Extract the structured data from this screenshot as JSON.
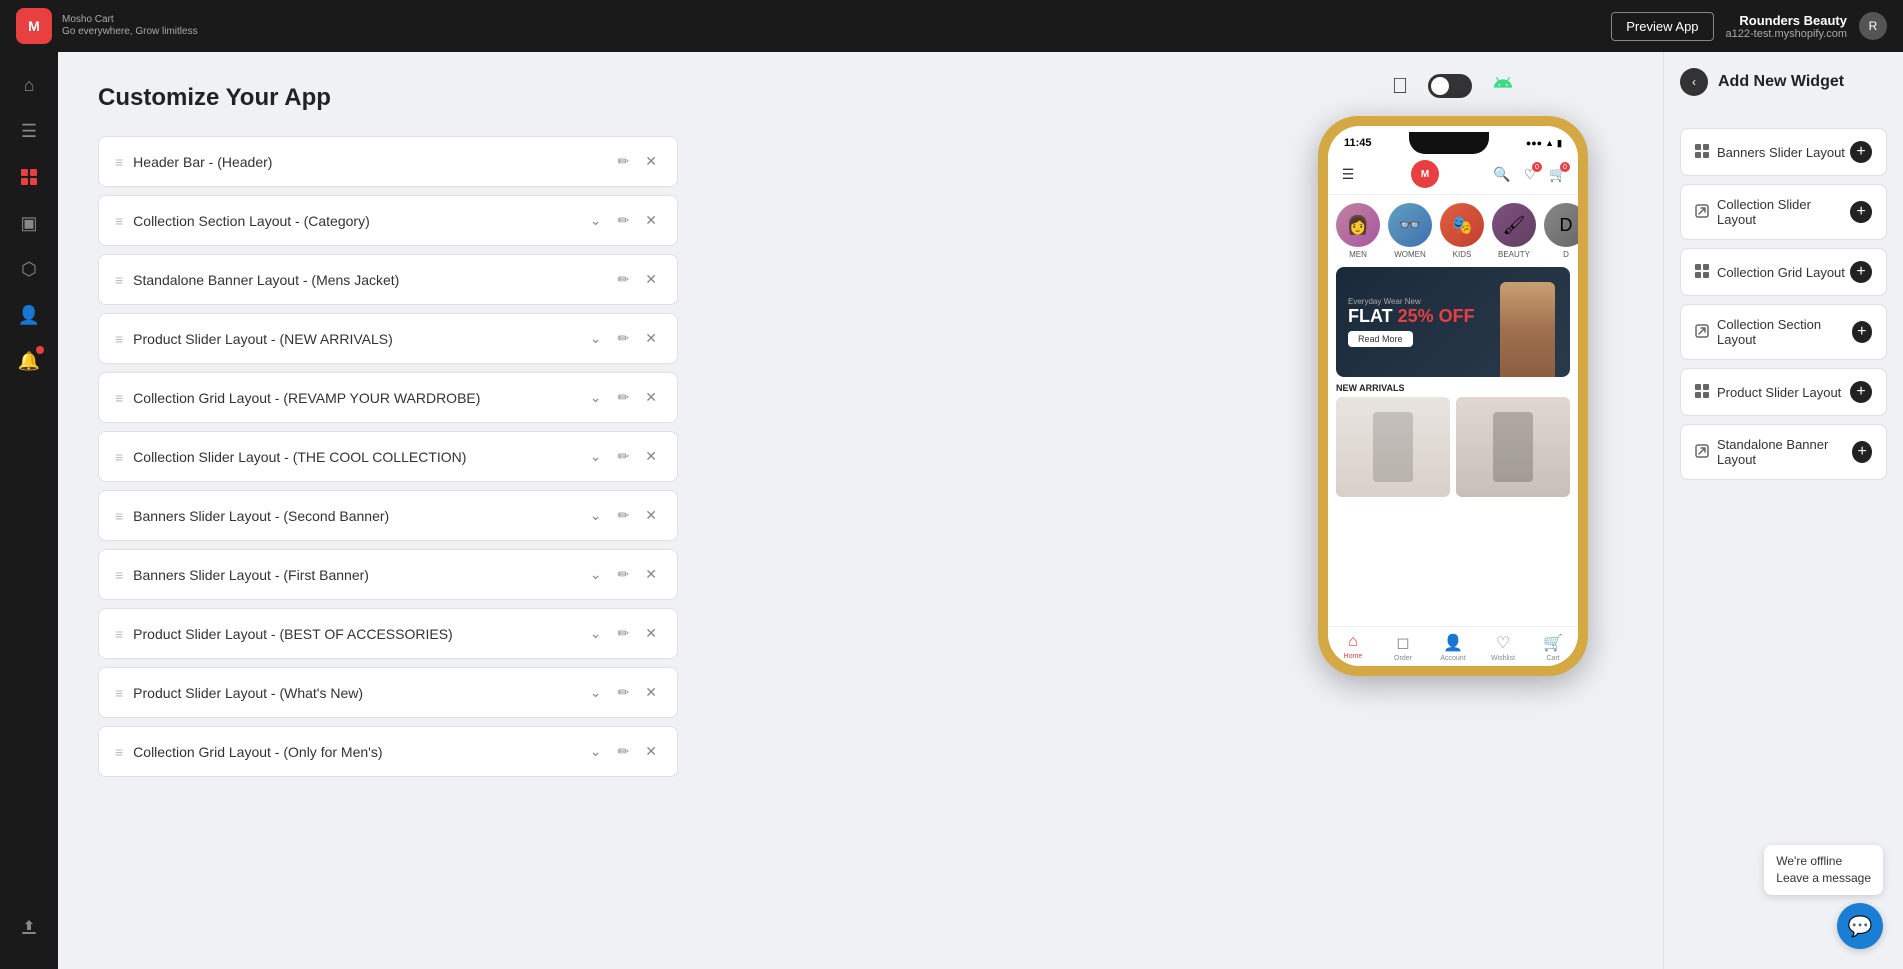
{
  "topbar": {
    "logo_letter": "M",
    "app_name": "Mosho Cart",
    "tagline": "Go everywhere, Grow limitless",
    "preview_label": "Preview App",
    "store_name": "Rounders Beauty",
    "store_url": "a122-test.myshopify.com"
  },
  "sidebar": {
    "icons": [
      {
        "name": "home-icon",
        "symbol": "⌂",
        "active": false
      },
      {
        "name": "menu-icon",
        "symbol": "☰",
        "active": false
      },
      {
        "name": "grid-icon",
        "symbol": "⊞",
        "active": true
      },
      {
        "name": "document-icon",
        "symbol": "▣",
        "active": false
      },
      {
        "name": "tag-icon",
        "symbol": "⬡",
        "active": false
      },
      {
        "name": "users-icon",
        "symbol": "👤",
        "active": false
      },
      {
        "name": "bell-icon",
        "symbol": "🔔",
        "active": false
      }
    ],
    "bottom_icon": {
      "name": "export-icon",
      "symbol": "⬆"
    }
  },
  "page": {
    "title": "Customize Your App"
  },
  "widgets": [
    {
      "id": 1,
      "name": "Header Bar - (Header)",
      "has_expand": false,
      "draggable": true
    },
    {
      "id": 2,
      "name": "Collection Section Layout - (Category)",
      "has_expand": true,
      "draggable": true
    },
    {
      "id": 3,
      "name": "Standalone Banner Layout - (Mens Jacket)",
      "has_expand": false,
      "draggable": true
    },
    {
      "id": 4,
      "name": "Product Slider Layout - (NEW ARRIVALS)",
      "has_expand": true,
      "draggable": true
    },
    {
      "id": 5,
      "name": "Collection Grid Layout - (REVAMP YOUR WARDROBE)",
      "has_expand": true,
      "draggable": true
    },
    {
      "id": 6,
      "name": "Collection Slider Layout - (THE COOL COLLECTION)",
      "has_expand": true,
      "draggable": true
    },
    {
      "id": 7,
      "name": "Banners Slider Layout - (Second Banner)",
      "has_expand": true,
      "draggable": true
    },
    {
      "id": 8,
      "name": "Banners Slider Layout - (First Banner)",
      "has_expand": true,
      "draggable": true
    },
    {
      "id": 9,
      "name": "Product Slider Layout - (BEST OF ACCESSORIES)",
      "has_expand": true,
      "draggable": true
    },
    {
      "id": 10,
      "name": "Product Slider Layout - (What's New)",
      "has_expand": true,
      "draggable": true
    },
    {
      "id": 11,
      "name": "Collection Grid Layout - (Only for Men's)",
      "has_expand": true,
      "draggable": true
    }
  ],
  "phone": {
    "time": "11:45",
    "os_toggle": {
      "apple_label": "",
      "android_label": ""
    },
    "categories": [
      {
        "name": "MEN",
        "class": "men"
      },
      {
        "name": "WOMEN",
        "class": "women"
      },
      {
        "name": "KIDS",
        "class": "kids"
      },
      {
        "name": "BEAUTY",
        "class": "beauty"
      },
      {
        "name": "D",
        "class": "more"
      }
    ],
    "banner": {
      "small_text": "Everyday Wear New",
      "large_text": "FLAT 25% OFF",
      "button_label": "Read More"
    },
    "new_arrivals_label": "NEW ARRIVALS",
    "bottom_nav": [
      {
        "label": "Home",
        "icon": "⌂",
        "active": true
      },
      {
        "label": "Order",
        "icon": "📦",
        "active": false
      },
      {
        "label": "Account",
        "icon": "👤",
        "active": false
      },
      {
        "label": "Wishlist",
        "icon": "♡",
        "active": false
      },
      {
        "label": "Cart",
        "icon": "🛒",
        "active": false
      }
    ]
  },
  "right_panel": {
    "title": "Add New Widget",
    "items": [
      {
        "name": "Banners Slider Layout",
        "icon": "⊞",
        "type": "grid"
      },
      {
        "name": "Collection Slider Layout",
        "icon": "⧉",
        "type": "external"
      },
      {
        "name": "Collection Grid Layout",
        "icon": "⊞",
        "type": "grid"
      },
      {
        "name": "Collection Section Layout",
        "icon": "⧉",
        "type": "external"
      },
      {
        "name": "Product Slider Layout",
        "icon": "⊞",
        "type": "grid"
      },
      {
        "name": "Standalone Banner Layout",
        "icon": "⧉",
        "type": "external"
      }
    ]
  },
  "chat": {
    "status_line1": "We're offline",
    "status_line2": "Leave a message",
    "button_icon": "💬"
  }
}
